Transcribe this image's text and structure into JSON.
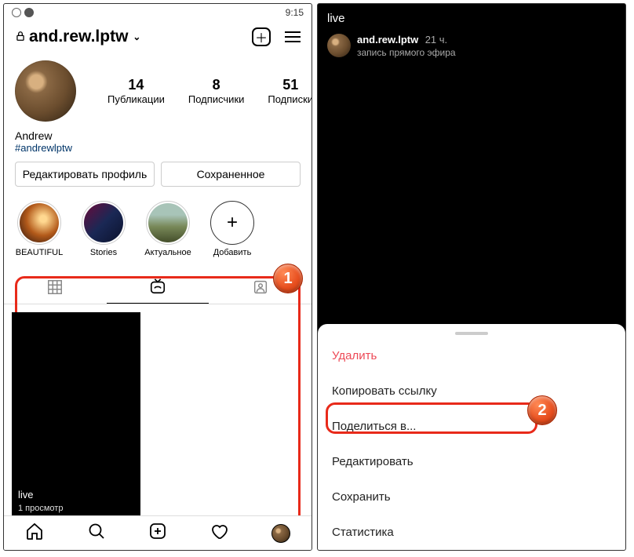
{
  "status": {
    "time": "9:15"
  },
  "profile": {
    "username": "and.rew.lptw",
    "stats": {
      "posts": {
        "value": "14",
        "label": "Публикации"
      },
      "followers": {
        "value": "8",
        "label": "Подписчики"
      },
      "following": {
        "value": "51",
        "label": "Подписки"
      }
    },
    "display_name": "Andrew",
    "hashtag": "#andrewlptw",
    "buttons": {
      "edit": "Редактировать профиль",
      "saved": "Сохраненное"
    }
  },
  "highlights": [
    {
      "label": "BEAUTIFUL"
    },
    {
      "label": "Stories"
    },
    {
      "label": "Актуальное"
    },
    {
      "label": "Добавить"
    }
  ],
  "video": {
    "title": "live",
    "views": "1 просмотр"
  },
  "badges": {
    "one": "1",
    "two": "2"
  },
  "right": {
    "title": "live",
    "username": "and.rew.lptw",
    "time": "21 ч.",
    "subtitle": "запись прямого эфира",
    "menu": {
      "delete": "Удалить",
      "copy": "Копировать ссылку",
      "share": "Поделиться в...",
      "edit": "Редактировать",
      "save": "Сохранить",
      "stats": "Статистика"
    }
  }
}
